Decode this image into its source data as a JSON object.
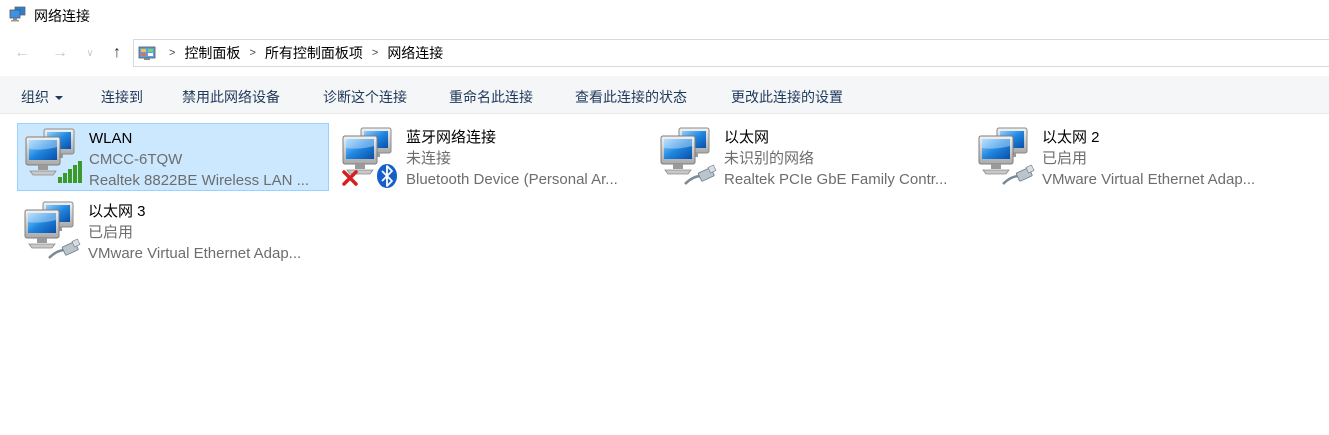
{
  "window": {
    "title": "网络连接"
  },
  "nav": {
    "back_glyph": "←",
    "forward_glyph": "→",
    "recent_glyph": "∨",
    "up_glyph": "↑"
  },
  "address": {
    "icon": "control-panel-icon",
    "items": [
      "控制面板",
      "所有控制面板项",
      "网络连接"
    ],
    "separator": ">"
  },
  "toolbar": {
    "organize": "组织",
    "connect": "连接到",
    "disable": "禁用此网络设备",
    "diagnose": "诊断这个连接",
    "rename": "重命名此连接",
    "status": "查看此连接的状态",
    "settings": "更改此连接的设置"
  },
  "connections": [
    {
      "name": "WLAN",
      "status": "CMCC-6TQW",
      "device": "Realtek 8822BE Wireless LAN ...",
      "icon": "wifi-signal-icon",
      "selected": true
    },
    {
      "name": "蓝牙网络连接",
      "status": "未连接",
      "device": "Bluetooth Device (Personal Ar...",
      "icon": "bluetooth-icon",
      "selected": false
    },
    {
      "name": "以太网",
      "status": "未识别的网络",
      "device": "Realtek PCIe GbE Family Contr...",
      "icon": "ethernet-cable-icon",
      "selected": false
    },
    {
      "name": "以太网 2",
      "status": "已启用",
      "device": "VMware Virtual Ethernet Adap...",
      "icon": "ethernet-cable-icon",
      "selected": false
    },
    {
      "name": "以太网 3",
      "status": "已启用",
      "device": "VMware Virtual Ethernet Adap...",
      "icon": "ethernet-cable-icon",
      "selected": false
    }
  ],
  "colors": {
    "selection_bg": "#cce8ff",
    "selection_border": "#99d1ff",
    "toolbar_text": "#1e395b",
    "subtext": "#6d6d6d"
  }
}
